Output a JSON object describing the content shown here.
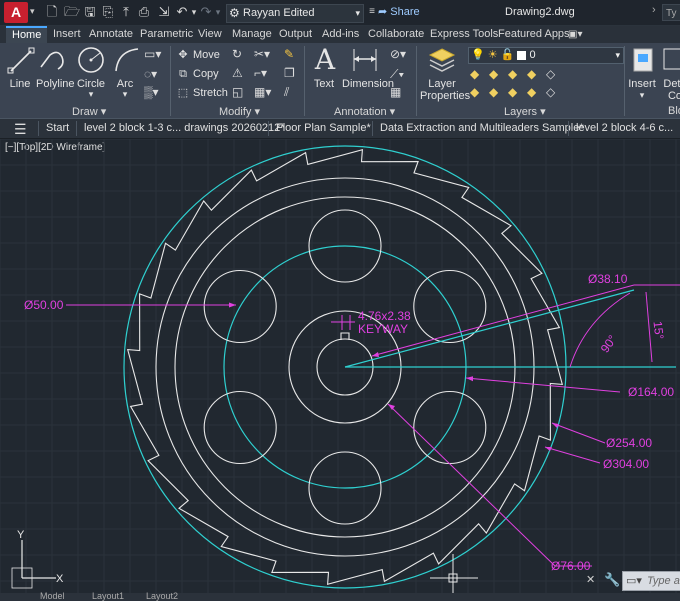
{
  "titlebar": {
    "app_letter": "A",
    "workspace": "Rayyan Edited",
    "share": "Share",
    "document_title": "Drawing2.dwg",
    "search_placeholder": "Ty"
  },
  "ribbon_tabs": [
    "Home",
    "Insert",
    "Annotate",
    "Parametric",
    "View",
    "Manage",
    "Output",
    "Add-ins",
    "Collaborate",
    "Express Tools",
    "Featured Apps"
  ],
  "ribbon": {
    "draw": {
      "line": "Line",
      "polyline": "Polyline",
      "circle": "Circle",
      "arc": "Arc",
      "panel": "Draw ▾"
    },
    "modify": {
      "move": "Move",
      "copy": "Copy",
      "stretch": "Stretch",
      "panel": "Modify ▾"
    },
    "annotation": {
      "text": "Text",
      "dimension": "Dimension",
      "panel": "Annotation ▾"
    },
    "layers": {
      "layer_properties_1": "Layer",
      "layer_properties_2": "Properties",
      "current_layer": "0",
      "panel": "Layers ▾"
    },
    "block": {
      "insert": "Insert",
      "detect_1": "Dete",
      "detect_2": "Co",
      "panel": "Blo"
    }
  },
  "file_tabs": [
    "Start",
    "level 2  block 1-3 c... drawings 20260212*",
    "Floor Plan Sample*",
    "Data Extraction and Multileaders Sample*",
    "level 2  block 4-6 c..."
  ],
  "viewport": {
    "label": "[−][Top][2D Wireframe]",
    "command_placeholder": "Type a c"
  },
  "drawing": {
    "dims": {
      "d50": "Ø50.00",
      "d38": "Ø38.10",
      "keyway_1": "4.76x2.38",
      "keyway_2": "KEYWAY",
      "angle90": "90°",
      "angle15": "15°",
      "d164": "Ø164.00",
      "d254": "Ø254.00",
      "d304": "Ø304.00",
      "d76": "Ø76.00"
    },
    "ucs_y": "Y",
    "ucs_x": "X"
  },
  "colors": {
    "dimension": "#e040e0",
    "cyan": "#2fd0d0",
    "white": "#e8e8e8",
    "background": "#212830"
  },
  "model_tabs": [
    "Model",
    "Layout1",
    "Layout2"
  ]
}
